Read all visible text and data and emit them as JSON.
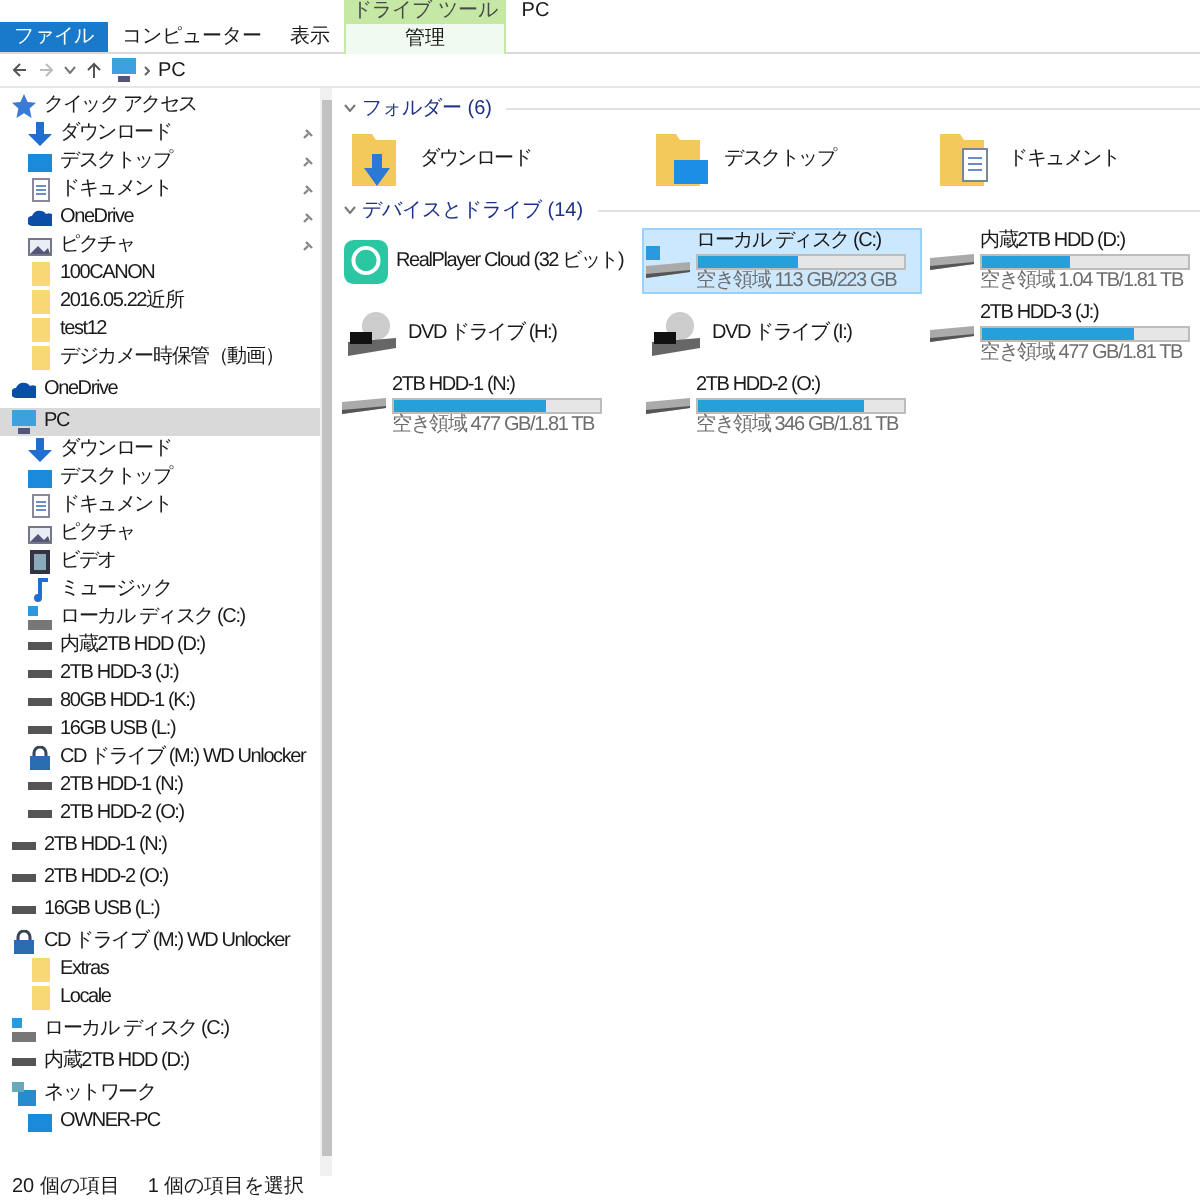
{
  "window": {
    "title": "PC",
    "tool_tab": "ドライブ ツール"
  },
  "ribbon_tabs": [
    {
      "label": "ファイル",
      "kind": "file",
      "selected": false
    },
    {
      "label": "コンピューター",
      "kind": "tab",
      "selected": false
    },
    {
      "label": "表示",
      "kind": "tab",
      "selected": false
    },
    {
      "label": "管理",
      "kind": "tool",
      "selected": false
    }
  ],
  "address": {
    "path": "PC"
  },
  "sidebar": {
    "items": [
      {
        "label": "クイック アクセス",
        "kind": "star",
        "selected": false,
        "children": [
          {
            "label": "ダウンロード",
            "kind": "download",
            "pinned": true,
            "selected": false
          },
          {
            "label": "デスクトップ",
            "kind": "desktop",
            "pinned": true,
            "selected": false
          },
          {
            "label": "ドキュメント",
            "kind": "document",
            "pinned": true,
            "selected": false
          },
          {
            "label": "OneDrive",
            "kind": "cloud",
            "pinned": true,
            "selected": false
          },
          {
            "label": "ピクチャ",
            "kind": "picture",
            "pinned": true,
            "selected": false
          },
          {
            "label": "100CANON",
            "kind": "folder",
            "pinned": false,
            "selected": false
          },
          {
            "label": "2016.05.22近所",
            "kind": "folder",
            "pinned": false,
            "selected": false
          },
          {
            "label": "test12",
            "kind": "folder",
            "pinned": false,
            "selected": false
          },
          {
            "label": "デジカメー時保管（動画）",
            "kind": "folder",
            "pinned": false,
            "selected": false
          }
        ]
      },
      {
        "label": "OneDrive",
        "kind": "cloud",
        "selected": false
      },
      {
        "label": "PC",
        "kind": "pc",
        "selected": true,
        "children": [
          {
            "label": "ダウンロード",
            "kind": "download",
            "selected": false
          },
          {
            "label": "デスクトップ",
            "kind": "desktop",
            "selected": false
          },
          {
            "label": "ドキュメント",
            "kind": "document",
            "selected": false
          },
          {
            "label": "ピクチャ",
            "kind": "picture",
            "selected": false
          },
          {
            "label": "ビデオ",
            "kind": "video",
            "selected": false
          },
          {
            "label": "ミュージック",
            "kind": "music",
            "selected": false
          },
          {
            "label": "ローカル ディスク (C:)",
            "kind": "windrive",
            "selected": false
          },
          {
            "label": "内蔵2TB HDD (D:)",
            "kind": "hdd",
            "selected": false
          },
          {
            "label": "2TB HDD-3 (J:)",
            "kind": "hdd",
            "selected": false
          },
          {
            "label": "80GB HDD-1 (K:)",
            "kind": "hdd",
            "selected": false
          },
          {
            "label": "16GB USB (L:)",
            "kind": "hdd",
            "selected": false
          },
          {
            "label": "CD ドライブ (M:) WD Unlocker",
            "kind": "cd",
            "selected": false
          },
          {
            "label": "2TB HDD-1 (N:)",
            "kind": "hdd",
            "selected": false
          },
          {
            "label": "2TB HDD-2 (O:)",
            "kind": "hdd",
            "selected": false
          }
        ]
      },
      {
        "label": "2TB HDD-1 (N:)",
        "kind": "hdd",
        "selected": false
      },
      {
        "label": "2TB HDD-2 (O:)",
        "kind": "hdd",
        "selected": false
      },
      {
        "label": "16GB USB (L:)",
        "kind": "hdd",
        "selected": false
      },
      {
        "label": "CD ドライブ (M:) WD Unlocker",
        "kind": "cd",
        "selected": false,
        "children": [
          {
            "label": "Extras",
            "kind": "folder",
            "selected": false
          },
          {
            "label": "Locale",
            "kind": "folder",
            "selected": false
          }
        ]
      },
      {
        "label": "ローカル ディスク (C:)",
        "kind": "windrive",
        "selected": false
      },
      {
        "label": "内蔵2TB HDD (D:)",
        "kind": "hdd",
        "selected": false
      },
      {
        "label": "ネットワーク",
        "kind": "network",
        "selected": false,
        "children": [
          {
            "label": "OWNER-PC",
            "kind": "desktop",
            "selected": false
          }
        ]
      }
    ]
  },
  "sections": [
    {
      "title": "フォルダー (6)",
      "items": [
        {
          "kind": "download",
          "name": "ダウンロード",
          "selected": false
        },
        {
          "kind": "desktop",
          "name": "デスクトップ",
          "selected": false
        },
        {
          "kind": "document",
          "name": "ドキュメント",
          "selected": false
        }
      ]
    },
    {
      "title": "デバイスとドライブ (14)",
      "items": [
        {
          "kind": "app",
          "name": "RealPlayer Cloud (32 ビット)",
          "selected": false
        },
        {
          "kind": "windrive",
          "name": "ローカル ディスク (C:)",
          "level": 0.49,
          "free": "空き領域 113 GB/223 GB",
          "selected": true
        },
        {
          "kind": "hdd",
          "name": "内蔵2TB HDD (D:)",
          "level": 0.43,
          "free": "空き領域 1.04 TB/1.81 TB",
          "selected": false
        },
        {
          "kind": "dvd",
          "name": "DVD ドライブ (H:)",
          "selected": false
        },
        {
          "kind": "dvd",
          "name": "DVD ドライブ (I:)",
          "selected": false
        },
        {
          "kind": "hdd",
          "name": "2TB HDD-3 (J:)",
          "level": 0.74,
          "free": "空き領域 477 GB/1.81 TB",
          "selected": false
        },
        {
          "kind": "hdd",
          "name": "2TB HDD-1 (N:)",
          "level": 0.74,
          "free": "空き領域 477 GB/1.81 TB",
          "selected": false
        },
        {
          "kind": "hdd",
          "name": "2TB HDD-2 (O:)",
          "level": 0.81,
          "free": "空き領域 346 GB/1.81 TB",
          "selected": false
        }
      ]
    }
  ],
  "status_bar": {
    "count": "20 個の項目",
    "selection": "1 個の項目を選択"
  }
}
